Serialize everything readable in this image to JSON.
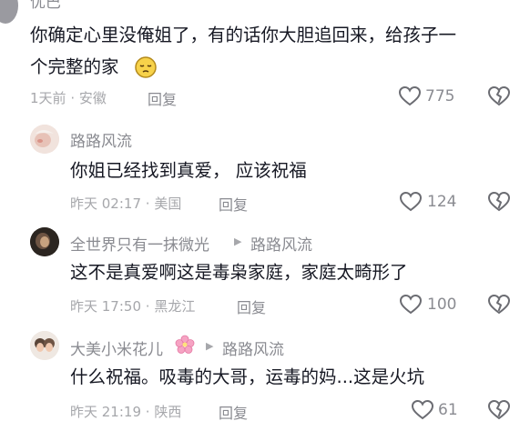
{
  "top_comment": {
    "username": "优巴",
    "text_line1": "你确定心里没俺姐了，有的话你大胆追回来，给孩子一",
    "text_line2": "个完整的家",
    "emoji_icon": "pensive-face-icon",
    "time": "1天前",
    "location": "安徽",
    "reply_label": "回复",
    "likes": "775"
  },
  "replies": [
    {
      "username": "路路风流",
      "reply_to": "",
      "text": "你姐已经找到真爱， 应该祝福",
      "time": "昨天 02:17",
      "location": "美国",
      "reply_label": "回复",
      "likes": "124"
    },
    {
      "username": "全世界只有一抹微光",
      "reply_to": "路路风流",
      "text": "这不是真爱啊这是毒枭家庭，家庭太畸形了",
      "time": "昨天 17:50",
      "location": "黑龙江",
      "reply_label": "回复",
      "likes": "100"
    },
    {
      "username": "大美小米花儿",
      "name_emoji": "cherry-blossom-icon",
      "reply_to": "路路风流",
      "text": "什么祝福。吸毒的大哥，运毒的妈...这是火坑",
      "time": "昨天 21:19",
      "location": "陕西",
      "reply_label": "回复",
      "likes": "61"
    }
  ],
  "meta_separator": "·",
  "reply_arrow": "▶",
  "colors": {
    "text": "#161823",
    "secondary": "#8a8b91",
    "muted": "#a6a7ab",
    "icon": "#6b6c72"
  }
}
